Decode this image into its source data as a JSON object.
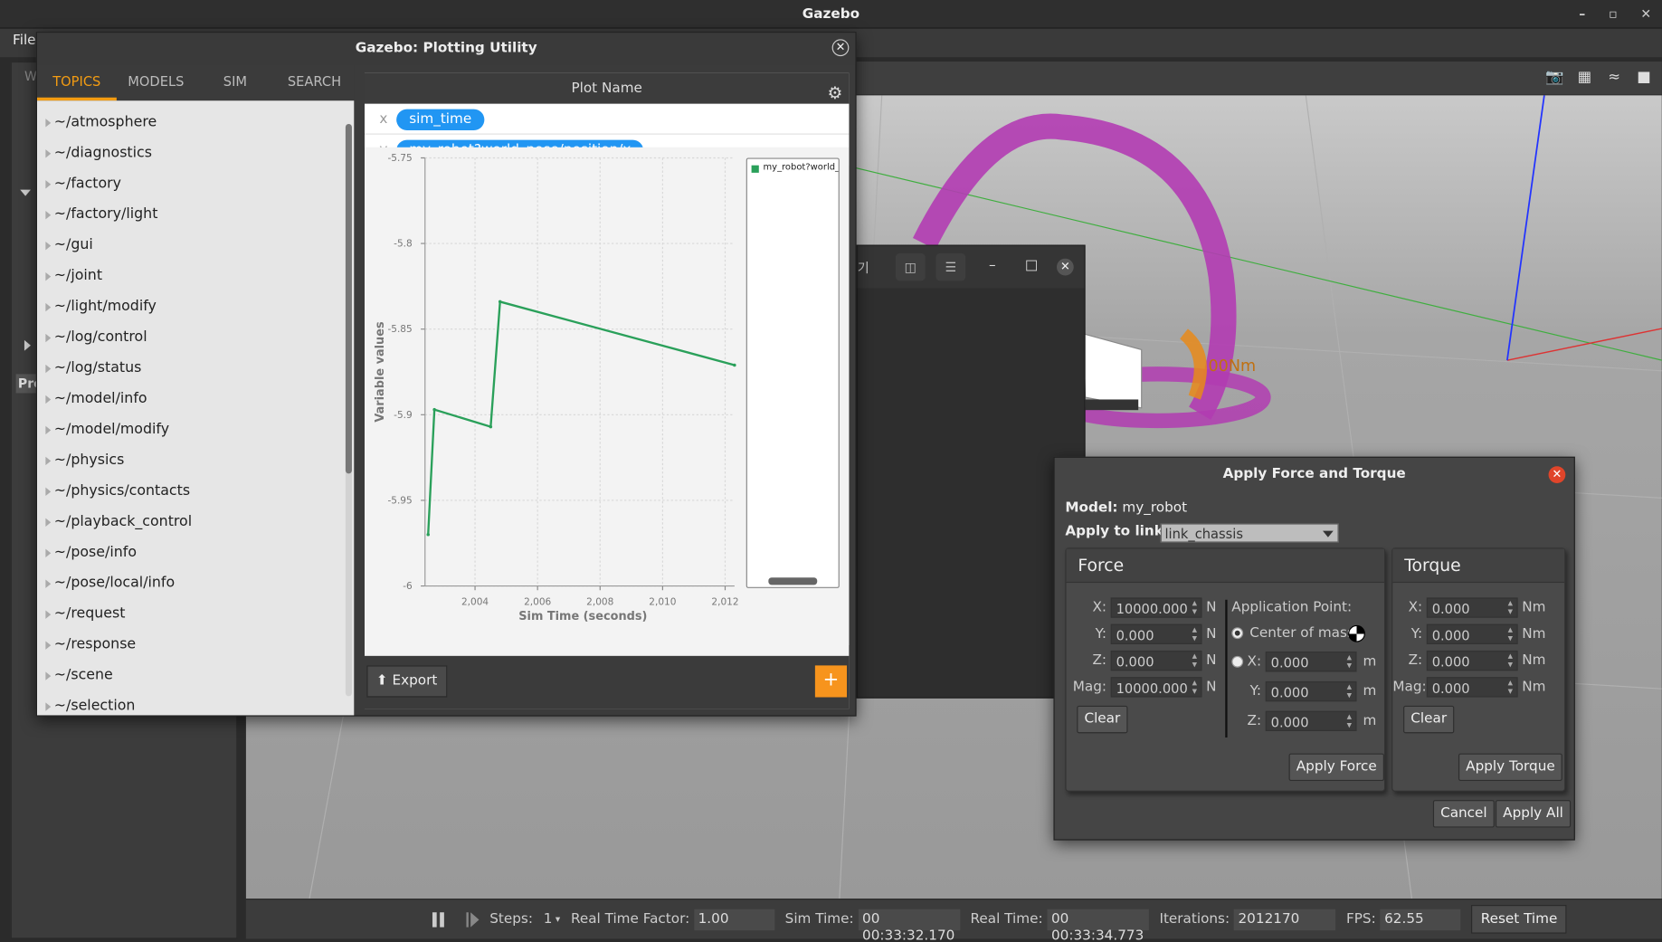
{
  "app": {
    "title": "Gazebo",
    "menu_file": "File",
    "left_panel_partial": "W",
    "left_panel_badge": "Pro"
  },
  "plot_window": {
    "title": "Gazebo: Plotting Utility",
    "tabs": [
      "TOPICS",
      "MODELS",
      "SIM",
      "SEARCH"
    ],
    "active_tab": "TOPICS",
    "topics": [
      "~/atmosphere",
      "~/diagnostics",
      "~/factory",
      "~/factory/light",
      "~/gui",
      "~/joint",
      "~/light/modify",
      "~/log/control",
      "~/log/status",
      "~/model/info",
      "~/model/modify",
      "~/physics",
      "~/physics/contacts",
      "~/playback_control",
      "~/pose/info",
      "~/pose/local/info",
      "~/request",
      "~/response",
      "~/scene",
      "~/selection"
    ],
    "plot_name": "Plot Name",
    "x_axis_label": "x",
    "x_variable": "sim_time",
    "y_axis_label": "y",
    "y_variable": "my_robot?world_pose/position/x",
    "export_label": "Export",
    "add_label": "+"
  },
  "chart_data": {
    "type": "line",
    "title": "",
    "xlabel": "Sim Time (seconds)",
    "ylabel": "Variable values",
    "xlim": [
      2002.4,
      2012.3
    ],
    "ylim": [
      -6,
      -5.75
    ],
    "xticks": [
      2004,
      2006,
      2008,
      2010,
      2012
    ],
    "xtick_labels": [
      "2,004",
      "2,006",
      "2,008",
      "2,010",
      "2,012"
    ],
    "yticks": [
      -5.75,
      -5.8,
      -5.85,
      -5.9,
      -5.95,
      -6
    ],
    "ytick_labels": [
      "-5.75",
      "-5.8",
      "-5.85",
      "-5.9",
      "-5.95",
      "-6"
    ],
    "legend_position": "right",
    "series": [
      {
        "name": "my_robot?world_pose/position/x",
        "color": "#2aa05a",
        "x": [
          2002.5,
          2002.7,
          2004.5,
          2004.8,
          2012.3
        ],
        "y": [
          -5.97,
          -5.897,
          -5.907,
          -5.834,
          -5.871
        ]
      }
    ]
  },
  "background_dialog": {
    "partial_title": "기"
  },
  "force_dialog": {
    "title": "Apply Force and Torque",
    "model_label": "Model:",
    "model_value": "my_robot",
    "link_label": "Apply to link:",
    "link_value": "link_chassis",
    "force": {
      "header": "Force",
      "x_label": "X:",
      "x_value": "10000.000",
      "y_label": "Y:",
      "y_value": "0.000",
      "z_label": "Z:",
      "z_value": "0.000",
      "mag_label": "Mag:",
      "mag_value": "10000.000",
      "unit": "N",
      "clear_label": "Clear",
      "apply_label": "Apply Force",
      "app_point_label": "Application Point:",
      "center_of_mass_label": "Center of mass",
      "ap_x_label": "X:",
      "ap_x_value": "0.000",
      "ap_y_label": "Y:",
      "ap_y_value": "0.000",
      "ap_z_label": "Z:",
      "ap_z_value": "0.000",
      "ap_unit": "m"
    },
    "torque": {
      "header": "Torque",
      "x_label": "X:",
      "x_value": "0.000",
      "y_label": "Y:",
      "y_value": "0.000",
      "z_label": "Z:",
      "z_value": "0.000",
      "mag_label": "Mag:",
      "mag_value": "0.000",
      "unit": "Nm",
      "clear_label": "Clear",
      "apply_label": "Apply Torque"
    },
    "cancel_label": "Cancel",
    "apply_all_label": "Apply All"
  },
  "viewport": {
    "torque_overlay_text": "00Nm"
  },
  "status_bar": {
    "steps_label": "Steps:",
    "steps_value": "1",
    "rtf_label": "Real Time Factor:",
    "rtf_value": "1.00",
    "sim_time_label": "Sim Time:",
    "sim_time_value": "00 00:33:32.170",
    "real_time_label": "Real Time:",
    "real_time_value": "00 00:33:34.773",
    "iterations_label": "Iterations:",
    "iterations_value": "2012170",
    "fps_label": "FPS:",
    "fps_value": "62.55",
    "reset_label": "Reset Time"
  }
}
